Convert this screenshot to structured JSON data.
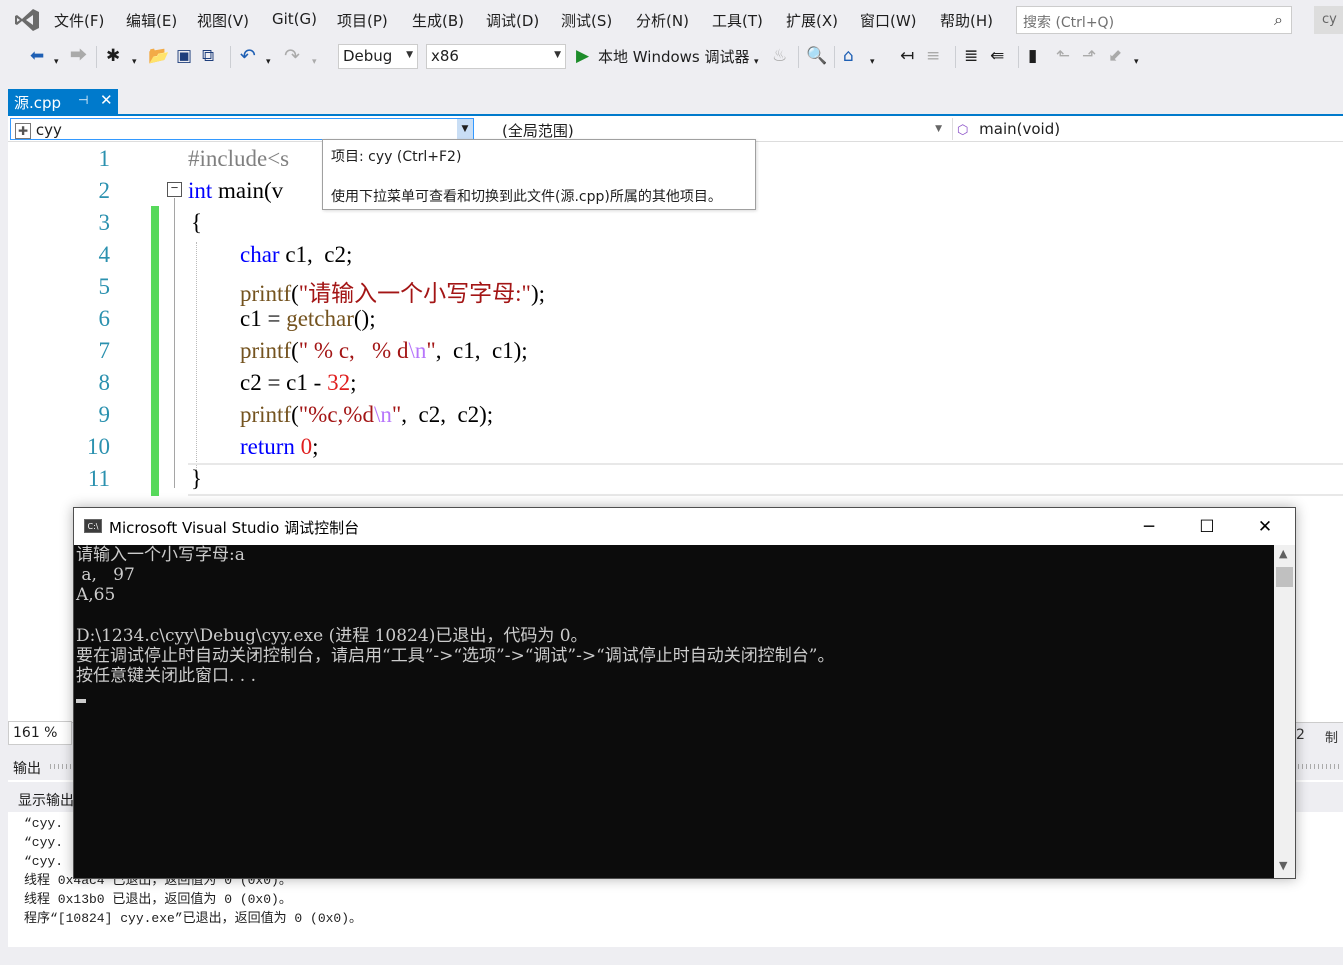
{
  "menu": {
    "items": [
      "文件(F)",
      "编辑(E)",
      "视图(V)",
      "Git(G)",
      "项目(P)",
      "生成(B)",
      "调试(D)",
      "测试(S)",
      "分析(N)",
      "工具(T)",
      "扩展(X)",
      "窗口(W)",
      "帮助(H)"
    ],
    "search_placeholder": "搜索 (Ctrl+Q)",
    "profile": "cy"
  },
  "toolbar": {
    "config": "Debug",
    "platform": "x86",
    "run_label": "本地 Windows 调试器"
  },
  "tab": {
    "label": "源.cpp",
    "pin": "⊣",
    "close": "✕"
  },
  "navbar": {
    "project": "cyy",
    "scope": "(全局范围)",
    "member": "main(void)"
  },
  "tooltip": {
    "title": "项目: cyy (Ctrl+F2)",
    "body": "使用下拉菜单可查看和切换到此文件(源.cpp)所属的其他项目。"
  },
  "editor": {
    "line_numbers": [
      "1",
      "2",
      "3",
      "4",
      "5",
      "6",
      "7",
      "8",
      "9",
      "10",
      "11"
    ],
    "zoom": "161 %"
  },
  "code": {
    "l1": "#include<s",
    "l2_kw": "int",
    "l2_rest": " main(v",
    "l3": "{",
    "l4_kw": "char",
    "l4_rest": " c1,  c2;",
    "l5_fn": "printf",
    "l5_open": "(",
    "l5_str": "\"请输入一个小写字母:\"",
    "l5_close": ");",
    "l6_a": "c1 = ",
    "l6_fn": "getchar",
    "l6_b": "();",
    "l7_fn": "printf",
    "l7_open": "(",
    "l7_str1": "\" % c,   % d",
    "l7_esc": "\\n",
    "l7_str2": "\"",
    "l7_close": ",  c1,  c1);",
    "l8_a": "c2 = c1 - ",
    "l8_num": "32",
    "l8_b": ";",
    "l9_fn": "printf",
    "l9_open": "(",
    "l9_str1": "\"%c,%d",
    "l9_esc": "\\n",
    "l9_str2": "\"",
    "l9_close": ",  c2,  c2);",
    "l10_kw": "return",
    "l10_num": "0",
    "l10_b": ";",
    "l11": "}"
  },
  "console": {
    "title": "Microsoft Visual Studio 调试控制台",
    "icon_text": "C:\\",
    "minimize": "─",
    "maximize": "☐",
    "close": "✕",
    "output": "请输入一个小写字母:a\n a,   97\nA,65\n\nD:\\1234.c\\cyy\\Debug\\cyy.exe (进程 10824)已退出，代码为 0。\n要在调试停止时自动关闭控制台，请启用“工具”->“选项”->“调试”->“调试停止时自动关闭控制台”。\n按任意键关闭此窗口. . ."
  },
  "output_panel": {
    "header": "输出",
    "source_label": "显示输出",
    "text": "“cyy.\n“cyy.\n“cyy.\n线程 0x4ac4 已退出，返回值为 0 (0x0)。\n线程 0x13b0 已退出，返回值为 0 (0x0)。\n程序“[10824] cyy.exe”已退出，返回值为 0 (0x0)。",
    "right_frag_num": "2",
    "right_frag_text": "制"
  },
  "colors": {
    "accent": "#007acc",
    "keyword": "#0000ff",
    "string": "#a31515",
    "change_bar": "#57d95b"
  }
}
